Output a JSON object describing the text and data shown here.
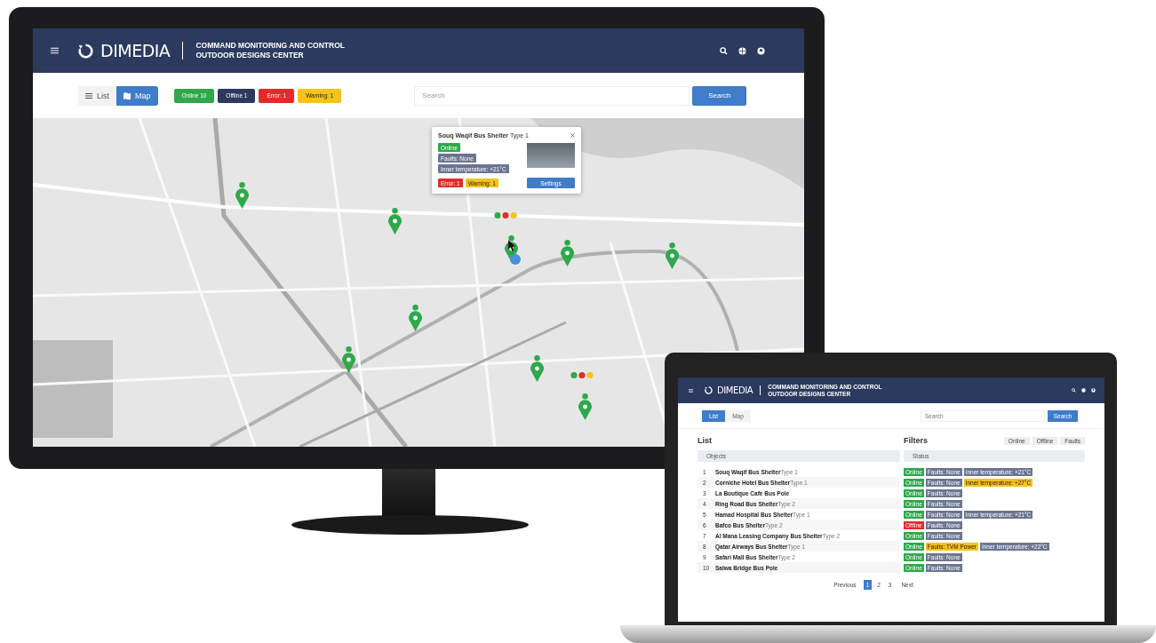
{
  "monitor": {
    "header": {
      "brand": "DIMEDIA",
      "title_lines": [
        "COMMAND MONITORING AND CONTROL",
        "OUTDOOR DESIGNS CENTER"
      ]
    },
    "view_tabs": [
      {
        "label": "List",
        "selected": false
      },
      {
        "label": "Map",
        "selected": true
      }
    ],
    "status_chips": [
      {
        "label": "Online 10",
        "color": "#2ea84a"
      },
      {
        "label": "Offline 1",
        "color": "#2c3a5e"
      },
      {
        "label": "Error: 1",
        "color": "#e52a2a"
      },
      {
        "label": "Warning: 1",
        "color": "#f7c21b"
      }
    ],
    "search": {
      "placeholder": "Search",
      "button": "Search"
    },
    "popup": {
      "title": "Souq Waqif Bus Shelter",
      "subtitle": "Type 1",
      "tags": [
        {
          "label": "Online",
          "color": "#2ea84a"
        },
        {
          "label": "Faults: None",
          "color": "#6b7591"
        },
        {
          "label": "Inner temperature: +21°C",
          "color": "#6b7591"
        }
      ],
      "alerts": [
        {
          "label": "Error: 1",
          "color": "#e52a2a"
        },
        {
          "label": "Warning: 1",
          "color": "#f7c21b"
        }
      ],
      "button": "Settings"
    }
  },
  "laptop": {
    "header": {
      "brand": "DIMEDIA",
      "title_lines": [
        "COMMAND MONITORING AND CONTROL",
        "OUTDOOR DESIGNS CENTER"
      ]
    },
    "view_tabs": [
      {
        "label": "List",
        "selected": true
      },
      {
        "label": "Map",
        "selected": false
      }
    ],
    "search": {
      "placeholder": "Search",
      "button": "Search"
    },
    "list_title": "List",
    "filters_title": "Filters",
    "filters": [
      "Online",
      "Offline",
      "Faults"
    ],
    "columns": [
      "Objects",
      "Status"
    ],
    "rows": [
      {
        "number": "1",
        "name": "Souq Waqif Bus Shelter",
        "type": "Type 1",
        "tags": [
          {
            "label": "Online",
            "color": "#2ea84a"
          },
          {
            "label": "Faults: None",
            "color": "#6b7591"
          },
          {
            "label": "Inner temperature: +21°C",
            "color": "#6b7591"
          }
        ]
      },
      {
        "number": "2",
        "name": "Corniche Hotel Bus Shelter",
        "type": "Type 1",
        "tags": [
          {
            "label": "Online",
            "color": "#2ea84a"
          },
          {
            "label": "Faults: None",
            "color": "#6b7591"
          },
          {
            "label": "Inner temperature: +27°C",
            "color": "#f7c21b"
          }
        ]
      },
      {
        "number": "3",
        "name": "La Boutique Cafe Bus Pole",
        "type": "",
        "tags": [
          {
            "label": "Online",
            "color": "#2ea84a"
          },
          {
            "label": "Faults: None",
            "color": "#6b7591"
          }
        ]
      },
      {
        "number": "4",
        "name": "Ring Road Bus Shelter",
        "type": "Type 2",
        "tags": [
          {
            "label": "Online",
            "color": "#2ea84a"
          },
          {
            "label": "Faults: None",
            "color": "#6b7591"
          }
        ]
      },
      {
        "number": "5",
        "name": "Hamad Hospital Bus Shelter",
        "type": "Type 1",
        "tags": [
          {
            "label": "Online",
            "color": "#2ea84a"
          },
          {
            "label": "Faults: None",
            "color": "#6b7591"
          },
          {
            "label": "Inner temperature: +21°C",
            "color": "#6b7591"
          }
        ]
      },
      {
        "number": "6",
        "name": "Bafco Bus Shelter",
        "type": "Type 2",
        "tags": [
          {
            "label": "Offline",
            "color": "#e52a2a"
          },
          {
            "label": "Faults: None",
            "color": "#6b7591"
          }
        ]
      },
      {
        "number": "7",
        "name": "Al Mana Leasing Company Bus Shelter",
        "type": "Type 2",
        "tags": [
          {
            "label": "Online",
            "color": "#2ea84a"
          },
          {
            "label": "Faults: None",
            "color": "#6b7591"
          }
        ]
      },
      {
        "number": "8",
        "name": "Qatar Airways Bus Shelter",
        "type": "Type 1",
        "tags": [
          {
            "label": "Online",
            "color": "#2ea84a"
          },
          {
            "label": "Faults: TVM Power",
            "color": "#f7c21b"
          },
          {
            "label": "Inner temperature: +22°C",
            "color": "#6b7591"
          }
        ]
      },
      {
        "number": "9",
        "name": "Safari Mall Bus Shelter",
        "type": "Type 2",
        "tags": [
          {
            "label": "Online",
            "color": "#2ea84a"
          },
          {
            "label": "Faults: None",
            "color": "#6b7591"
          }
        ]
      },
      {
        "number": "10",
        "name": "Salwa Bridge Bus Pole",
        "type": "",
        "tags": [
          {
            "label": "Online",
            "color": "#2ea84a"
          },
          {
            "label": "Faults: None",
            "color": "#6b7591"
          }
        ]
      }
    ],
    "pagination": {
      "previous": "Previous",
      "pages": [
        {
          "label": "1",
          "selected": true
        },
        {
          "label": "2",
          "selected": false
        },
        {
          "label": "3",
          "selected": false
        }
      ],
      "next": "Next"
    }
  }
}
